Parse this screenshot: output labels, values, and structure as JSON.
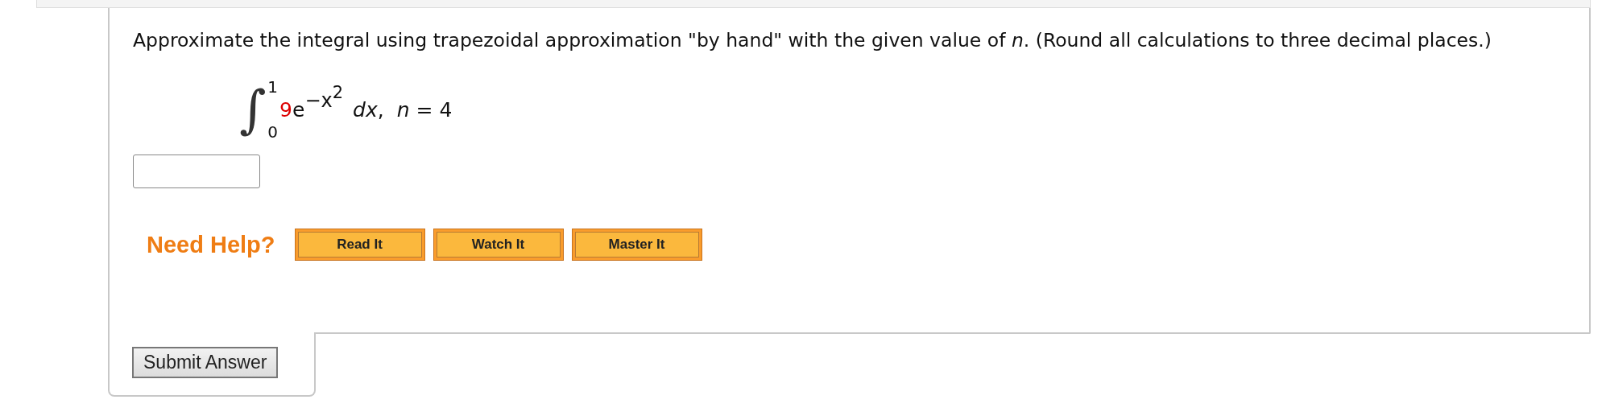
{
  "question": {
    "text": "Approximate the integral using trapezoidal approximation \"by hand\" with the given value of *n*. (Round all calculations to three decimal places.)",
    "integral": {
      "sign": "∫",
      "upper": "1",
      "lower": "0",
      "coefficient": "9",
      "base": "e",
      "exponent": "−x",
      "power": "2",
      "differential": "*dx*,",
      "condition": "*n* = 4"
    }
  },
  "help": {
    "label": "Need Help?",
    "buttons": [
      "Read It",
      "Watch It",
      "Master It"
    ]
  },
  "submit": {
    "label": "Submit Answer"
  }
}
